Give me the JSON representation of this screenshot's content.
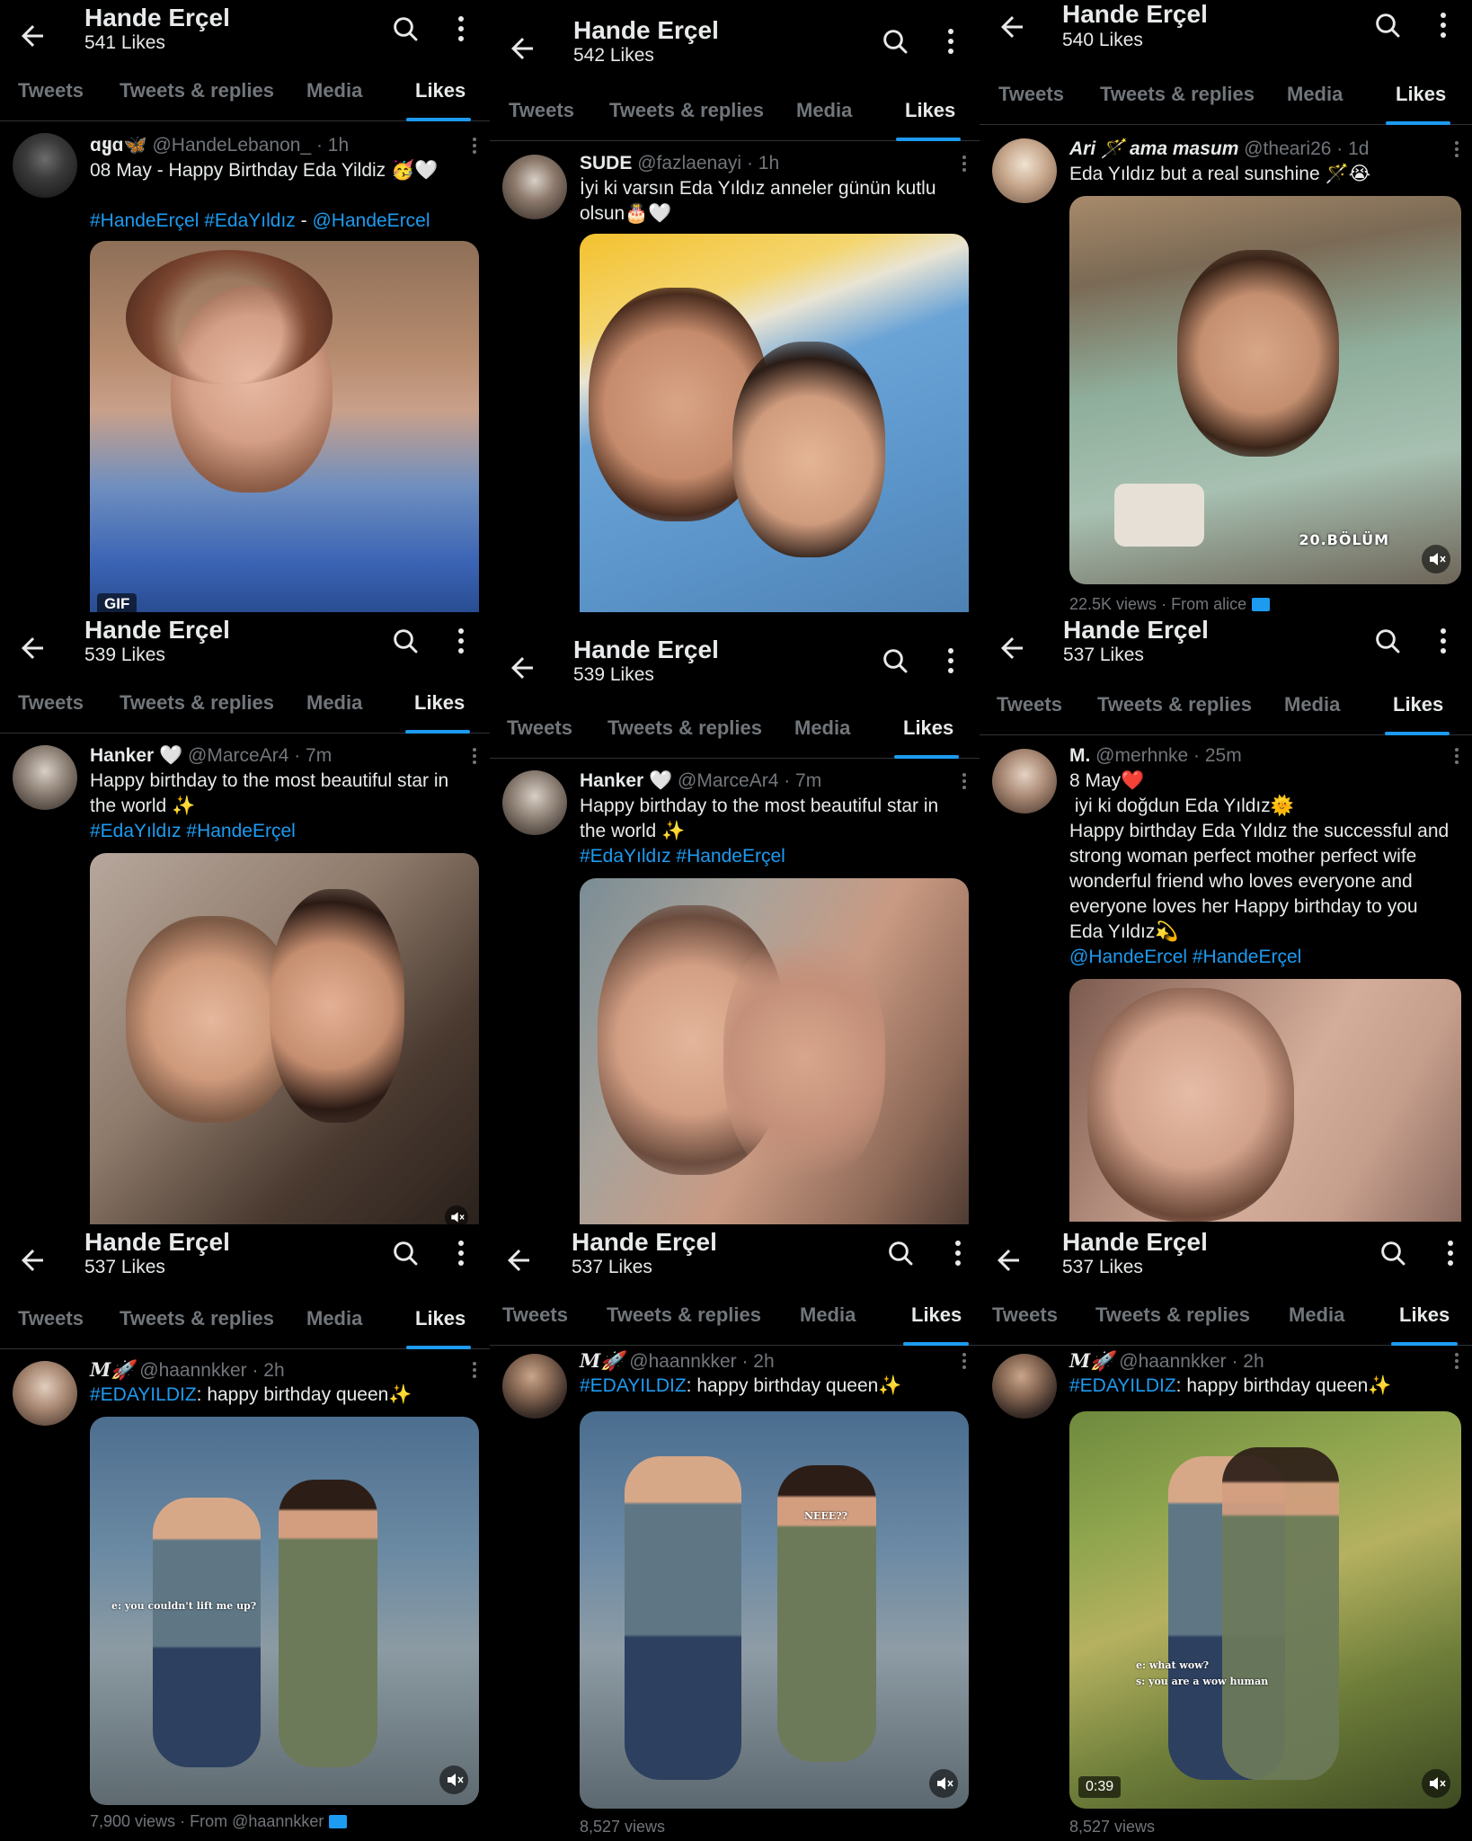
{
  "profile_name": "Hande Erçel",
  "tabs": [
    "Tweets",
    "Tweets & replies",
    "Media",
    "Likes"
  ],
  "panels": [
    {
      "likes": "541 Likes",
      "author": "ɑყɑ🦋",
      "handle": "@HandeLebanon_",
      "time": "· 1h",
      "text": "08 May - Happy Birthday Eda Yildiz 🥳🤍",
      "tags1": "#HandeErçel #EdaYıldız",
      "tags_sep": " - ",
      "tags2": "@HandeErcel",
      "badge": "GIF"
    },
    {
      "likes": "542 Likes",
      "author": "SUDE",
      "handle": "@fazlaenayi",
      "time": "· 1h",
      "text": "İyi ki varsın Eda Yıldız anneler günün kutlu olsun🎂🤍"
    },
    {
      "likes": "540 Likes",
      "author": "Ari 🪄 ama masum",
      "handle": "@theari26",
      "time": "· 1d",
      "text": "Eda Yıldız but a real sunshine 🪄😭",
      "overlay": "20.BÖLÜM",
      "views": "22.5K views",
      "from": "· From alice"
    },
    {
      "likes": "539 Likes",
      "author": "Hanker 🤍",
      "handle": "@MarceAr4",
      "time": "· 7m",
      "text": "Happy birthday to the most beautiful star in the world ✨",
      "tags": "#EdaYıldız #HandeErçel"
    },
    {
      "likes": "539 Likes",
      "author": "Hanker 🤍",
      "handle": "@MarceAr4",
      "time": "· 7m",
      "text": "Happy birthday to the most beautiful star in the world ✨",
      "tags": "#EdaYıldız #HandeErçel"
    },
    {
      "likes": "537 Likes",
      "author": "M.",
      "handle": "@merhnke",
      "time": "· 25m",
      "l1": "8 May❤️",
      "l2": " iyi ki doğdun Eda Yıldız🌞",
      "l3": "Happy birthday Eda Yıldız the successful and strong woman perfect mother perfect wife wonderful friend who loves everyone and everyone loves her Happy birthday to you  Eda Yıldız💫",
      "tags": "@HandeErcel #HandeErçel"
    },
    {
      "likes": "537 Likes",
      "author": "M🚀",
      "handle": "@haannkker",
      "time": "· 2h",
      "tag": "#EDAYILDIZ",
      "text": ": happy birthday queen✨",
      "sub1": "e: you couldn't lift me up?",
      "views": "7,900 views",
      "from": "· From @haannkker"
    },
    {
      "likes": "537 Likes",
      "author": "M🚀",
      "handle": "@haannkker",
      "time": "· 2h",
      "tag": "#EDAYILDIZ",
      "text": ": happy birthday queen✨",
      "sub1": "NEEE??",
      "views": "8,527 views"
    },
    {
      "likes": "537 Likes",
      "author": "M🚀",
      "handle": "@haannkker",
      "time": "· 2h",
      "tag": "#EDAYILDIZ",
      "text": ": happy birthday queen✨",
      "sub1": "e: what wow?",
      "sub2": "s: you are a wow human",
      "duration": "0:39",
      "views": "8,527 views"
    }
  ]
}
